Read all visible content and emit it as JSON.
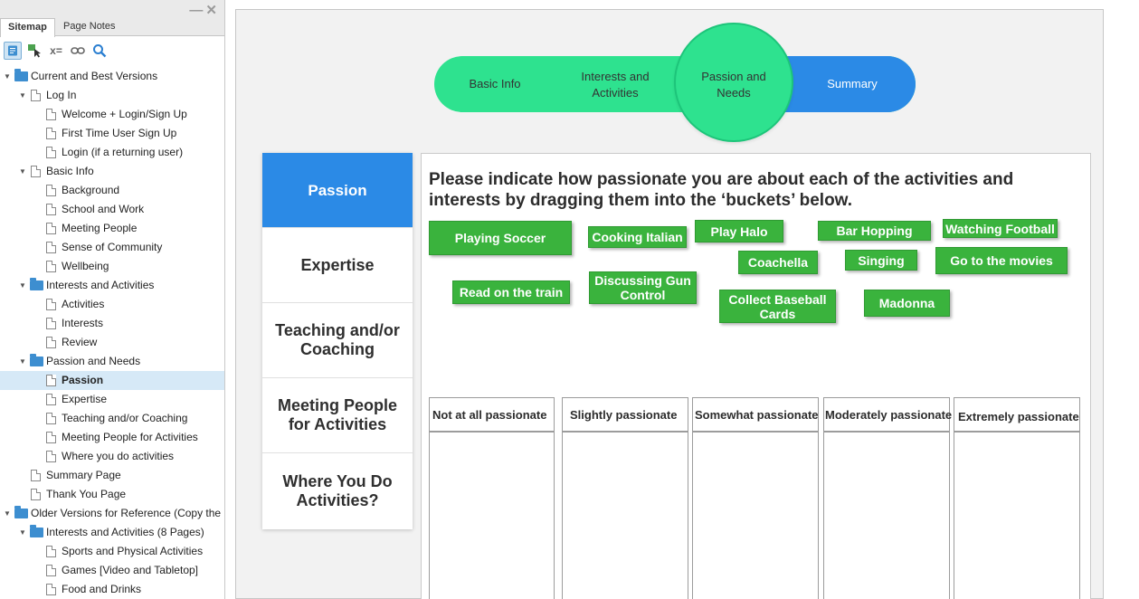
{
  "sidebar": {
    "tabs": [
      {
        "label": "Sitemap",
        "active": true
      },
      {
        "label": "Page Notes",
        "active": false
      }
    ],
    "window_controls": "—✕",
    "toolbar": [
      {
        "icon": "page-view-icon",
        "pressed": true
      },
      {
        "icon": "add-page-icon",
        "pressed": false
      },
      {
        "icon": "variables-icon",
        "glyph": "x=",
        "pressed": false
      },
      {
        "icon": "link-icon",
        "glyph": "↔",
        "pressed": false
      },
      {
        "icon": "search-icon",
        "glyph": "⌕",
        "pressed": false
      }
    ],
    "tree": [
      {
        "label": "Current and Best Versions",
        "type": "folder",
        "depth": 0,
        "expanded": true
      },
      {
        "label": "Log In",
        "type": "page",
        "depth": 1,
        "expanded": true
      },
      {
        "label": "Welcome + Login/Sign Up",
        "type": "page",
        "depth": 2
      },
      {
        "label": "First Time User Sign Up",
        "type": "page",
        "depth": 2
      },
      {
        "label": "Login (if a returning user)",
        "type": "page",
        "depth": 2
      },
      {
        "label": "Basic Info",
        "type": "page",
        "depth": 1,
        "expanded": true
      },
      {
        "label": "Background",
        "type": "page",
        "depth": 2
      },
      {
        "label": "School and Work",
        "type": "page",
        "depth": 2
      },
      {
        "label": "Meeting People",
        "type": "page",
        "depth": 2
      },
      {
        "label": "Sense of Community",
        "type": "page",
        "depth": 2
      },
      {
        "label": "Wellbeing",
        "type": "page",
        "depth": 2
      },
      {
        "label": "Interests and Activities",
        "type": "folder",
        "depth": 1,
        "expanded": true
      },
      {
        "label": "Activities",
        "type": "page",
        "depth": 2
      },
      {
        "label": "Interests",
        "type": "page",
        "depth": 2
      },
      {
        "label": "Review",
        "type": "page",
        "depth": 2
      },
      {
        "label": "Passion and Needs",
        "type": "folder",
        "depth": 1,
        "expanded": true
      },
      {
        "label": "Passion",
        "type": "page",
        "depth": 2,
        "selected": true
      },
      {
        "label": "Expertise",
        "type": "page",
        "depth": 2
      },
      {
        "label": "Teaching and/or Coaching",
        "type": "page",
        "depth": 2
      },
      {
        "label": "Meeting People for Activities",
        "type": "page",
        "depth": 2
      },
      {
        "label": "Where you do activities",
        "type": "page",
        "depth": 2
      },
      {
        "label": "Summary Page",
        "type": "page",
        "depth": 1
      },
      {
        "label": "Thank You Page",
        "type": "page",
        "depth": 1
      },
      {
        "label": "Older Versions for Reference (Copy the",
        "type": "folder",
        "depth": 0,
        "expanded": true
      },
      {
        "label": "Interests and Activities (8 Pages)",
        "type": "folder",
        "depth": 1,
        "expanded": true
      },
      {
        "label": "Sports and Physical Activities",
        "type": "page",
        "depth": 2
      },
      {
        "label": "Games [Video and Tabletop]",
        "type": "page",
        "depth": 2
      },
      {
        "label": "Food and Drinks",
        "type": "page",
        "depth": 2
      }
    ]
  },
  "stepper": {
    "steps": [
      {
        "label": "Basic Info"
      },
      {
        "label": "Interests and Activities"
      },
      {
        "label": "Passion and Needs",
        "current": true
      },
      {
        "label": "Summary"
      }
    ]
  },
  "categories": [
    {
      "label": "Passion",
      "active": true
    },
    {
      "label": "Expertise"
    },
    {
      "label": "Teaching and/or Coaching"
    },
    {
      "label": "Meeting People for Activities"
    },
    {
      "label": "Where You Do Activities?"
    }
  ],
  "task": {
    "prompt": "Please indicate how passionate you are about each of the activities and interests by dragging them into the ‘buckets’ below.",
    "chips": [
      "Playing Soccer",
      "Cooking Italian",
      "Play Halo",
      "Bar Hopping",
      "Watching Football",
      "Coachella",
      "Singing",
      "Go to the movies",
      "Read on the train",
      "Discussing Gun Control",
      "Collect Baseball Cards",
      "Madonna"
    ],
    "buckets": [
      "Not at all passionate",
      "Slightly passionate",
      "Somewhat passionate",
      "Moderately passionate",
      "Extremely passionate"
    ]
  },
  "colors": {
    "accent_green": "#2ee28f",
    "accent_blue": "#2b8ae6",
    "chip_green": "#3ab33d"
  }
}
